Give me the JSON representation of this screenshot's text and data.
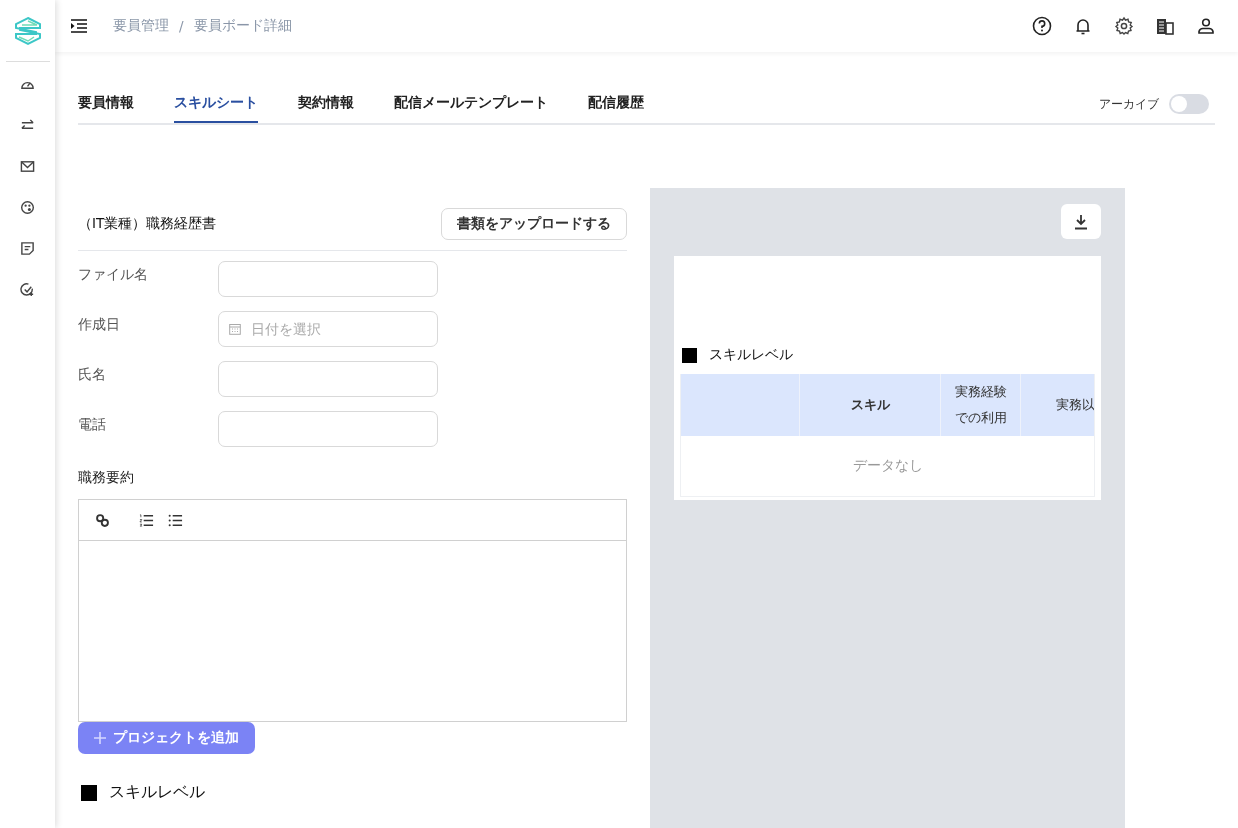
{
  "breadcrumb": [
    "要員管理",
    "要員ボード詳細"
  ],
  "breadcrumb_separator": "/",
  "tabs": [
    {
      "label": "要員情報",
      "selected": false
    },
    {
      "label": "スキルシート",
      "selected": true
    },
    {
      "label": "契約情報",
      "selected": false
    },
    {
      "label": "配信メールテンプレート",
      "selected": false
    },
    {
      "label": "配信履歴",
      "selected": false
    }
  ],
  "archive_toggle": {
    "label": "アーカイブ",
    "on": false
  },
  "resume": {
    "title": "（IT業種）職務経歴書",
    "upload_button": "書類をアップロードする",
    "fields": [
      {
        "label": "ファイル名",
        "kind": "text"
      },
      {
        "label": "作成日",
        "kind": "date",
        "placeholder": "日付を選択"
      },
      {
        "label": "氏名",
        "kind": "text"
      },
      {
        "label": "電話",
        "kind": "text"
      }
    ],
    "summary_label": "職務要約",
    "add_project_button": "プロジェクトを追加",
    "section_heading": "スキルレベル"
  },
  "preview": {
    "section_heading": "スキルレベル",
    "table": {
      "columns": [
        "スキル",
        "実務経験での利用",
        "実務以"
      ],
      "empty_text": "データなし"
    }
  }
}
